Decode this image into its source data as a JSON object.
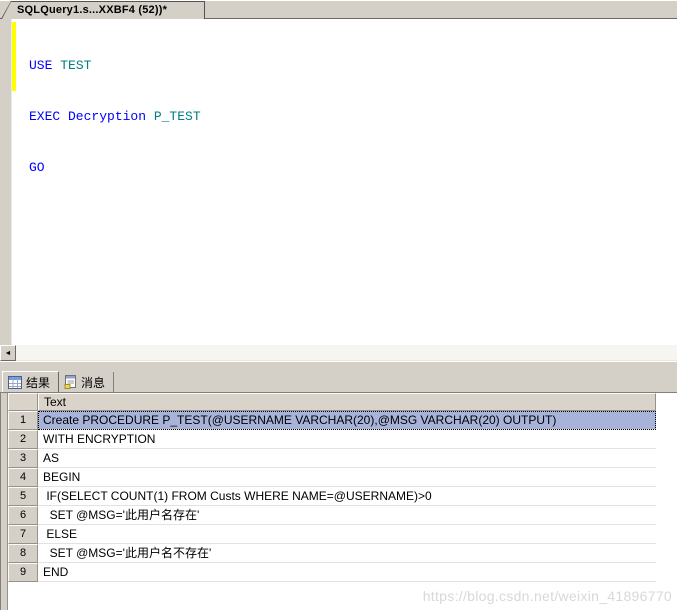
{
  "window": {
    "tab_title": "SQLQuery1.s...XXBF4 (52))*"
  },
  "editor": {
    "lines": [
      {
        "tokens": [
          {
            "t": "USE ",
            "c": "kw"
          },
          {
            "t": "TEST",
            "c": "obj"
          }
        ]
      },
      {
        "tokens": [
          {
            "t": "EXEC Decryption ",
            "c": "kw"
          },
          {
            "t": "P_TEST",
            "c": "obj"
          }
        ]
      },
      {
        "tokens": [
          {
            "t": "GO",
            "c": "kw"
          }
        ]
      }
    ]
  },
  "scrollbar": {
    "left_arrow": "◄"
  },
  "results": {
    "tabs": [
      {
        "label": "结果",
        "icon": "results-grid-icon"
      },
      {
        "label": "消息",
        "icon": "messages-icon"
      }
    ],
    "grid": {
      "columns": [
        "Text"
      ],
      "selected_row": 1,
      "rows": [
        {
          "num": "1",
          "text": "Create PROCEDURE P_TEST(@USERNAME VARCHAR(20),@MSG VARCHAR(20) OUTPUT)"
        },
        {
          "num": "2",
          "text": "WITH ENCRYPTION"
        },
        {
          "num": "3",
          "text": "AS"
        },
        {
          "num": "4",
          "text": "BEGIN"
        },
        {
          "num": "5",
          "text": " IF(SELECT COUNT(1) FROM Custs WHERE NAME=@USERNAME)>0"
        },
        {
          "num": "6",
          "text": "  SET @MSG='此用户名存在'"
        },
        {
          "num": "7",
          "text": " ELSE"
        },
        {
          "num": "8",
          "text": "  SET @MSG='此用户名不存在'"
        },
        {
          "num": "9",
          "text": "END"
        }
      ]
    }
  },
  "watermark": "https://blog.csdn.net/weixin_41896770",
  "colors": {
    "kw": "#0000ff",
    "obj": "#008080",
    "selection": "#a8b3da",
    "changebar": "#ffff00",
    "chrome": "#d4d0c8"
  }
}
